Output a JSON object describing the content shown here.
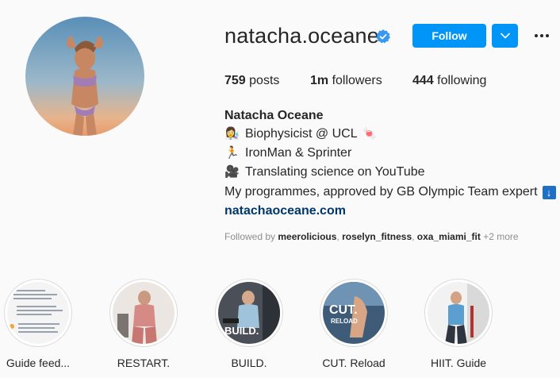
{
  "profile": {
    "username": "natacha.oceane",
    "verified": true,
    "follow_label": "Follow",
    "full_name": "Natacha Oceane",
    "website": "natachaoceane.com"
  },
  "stats": {
    "posts_count": "759",
    "posts_label": "posts",
    "followers_count": "1m",
    "followers_label": "followers",
    "following_count": "444",
    "following_label": "following"
  },
  "bio": {
    "line1": "Biophysicist @ UCL",
    "line2": "IronMan & Sprinter",
    "line3": "Translating science on YouTube",
    "line4": "My programmes, approved by GB Olympic Team expert"
  },
  "followed_by": {
    "prefix": "Followed by",
    "user1": "meerolicious",
    "user2": "roselyn_fitness",
    "user3": "oxa_miami_fit",
    "more": "+2 more"
  },
  "highlights": [
    {
      "label": "Guide feed..."
    },
    {
      "label": "RESTART."
    },
    {
      "label": "BUILD."
    },
    {
      "label": "CUT. Reload"
    },
    {
      "label": "HIIT. Guide"
    }
  ],
  "colors": {
    "accent": "#0095f6",
    "link": "#00376b",
    "verified": "#3897f0"
  }
}
